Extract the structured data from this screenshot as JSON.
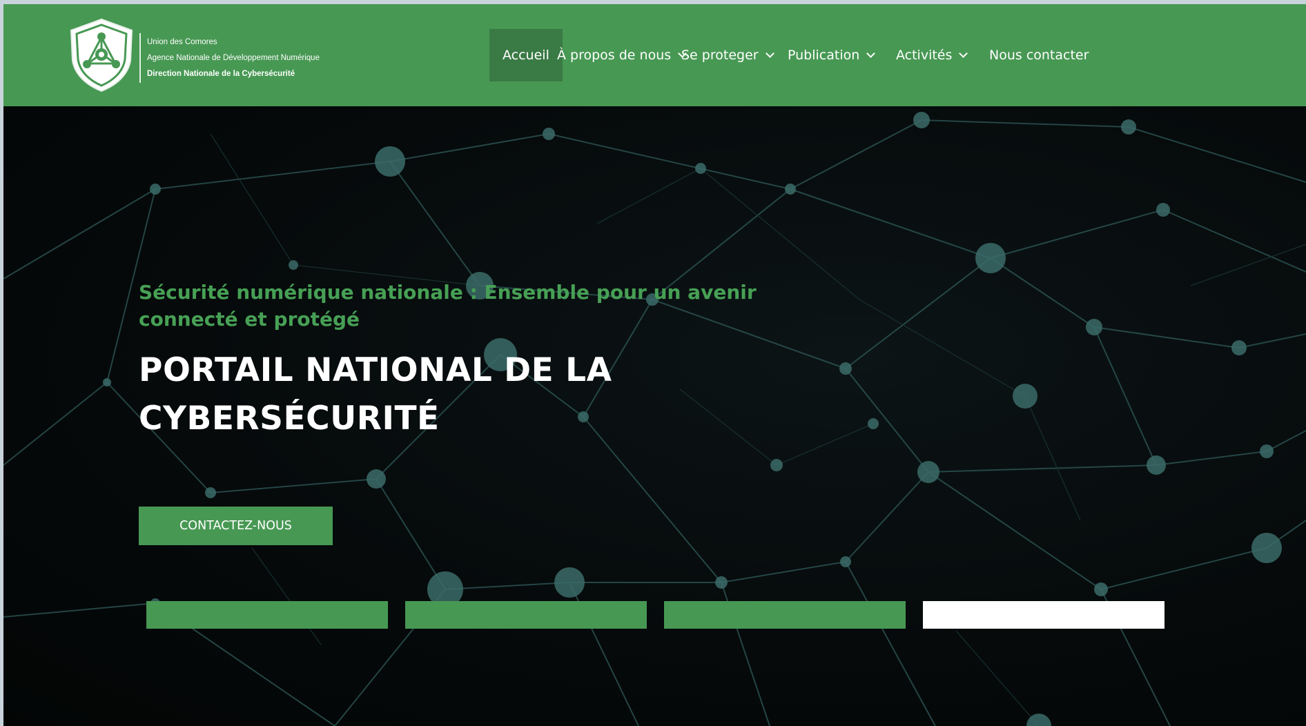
{
  "header": {
    "logo": {
      "line1": "Union des Comores",
      "line2": "Agence Nationale de Développement Numérique",
      "line3": "Direction Nationale de la Cybersécurité",
      "icon": "shield-network-icon"
    },
    "nav": [
      {
        "label": "Accueil",
        "active": true,
        "dropdown": false
      },
      {
        "label": "À propos de nous",
        "active": false,
        "dropdown": true
      },
      {
        "label": "Se proteger",
        "active": false,
        "dropdown": true
      },
      {
        "label": "Publication",
        "active": false,
        "dropdown": true
      },
      {
        "label": "Activités",
        "active": false,
        "dropdown": true
      },
      {
        "label": "Nous contacter",
        "active": false,
        "dropdown": false
      }
    ]
  },
  "hero": {
    "tagline": "Sécurité numérique nationale : Ensemble pour un avenir connecté et protégé",
    "headline_line1": "PORTAIL NATIONAL DE LA",
    "headline_line2": "CYBERSÉCURITÉ",
    "cta_label": "CONTACTEZ-NOUS"
  },
  "colors": {
    "brand_green": "#479853",
    "active_nav": "#3a7a45",
    "tagline_green": "#47a055",
    "hero_background": "#050708"
  }
}
